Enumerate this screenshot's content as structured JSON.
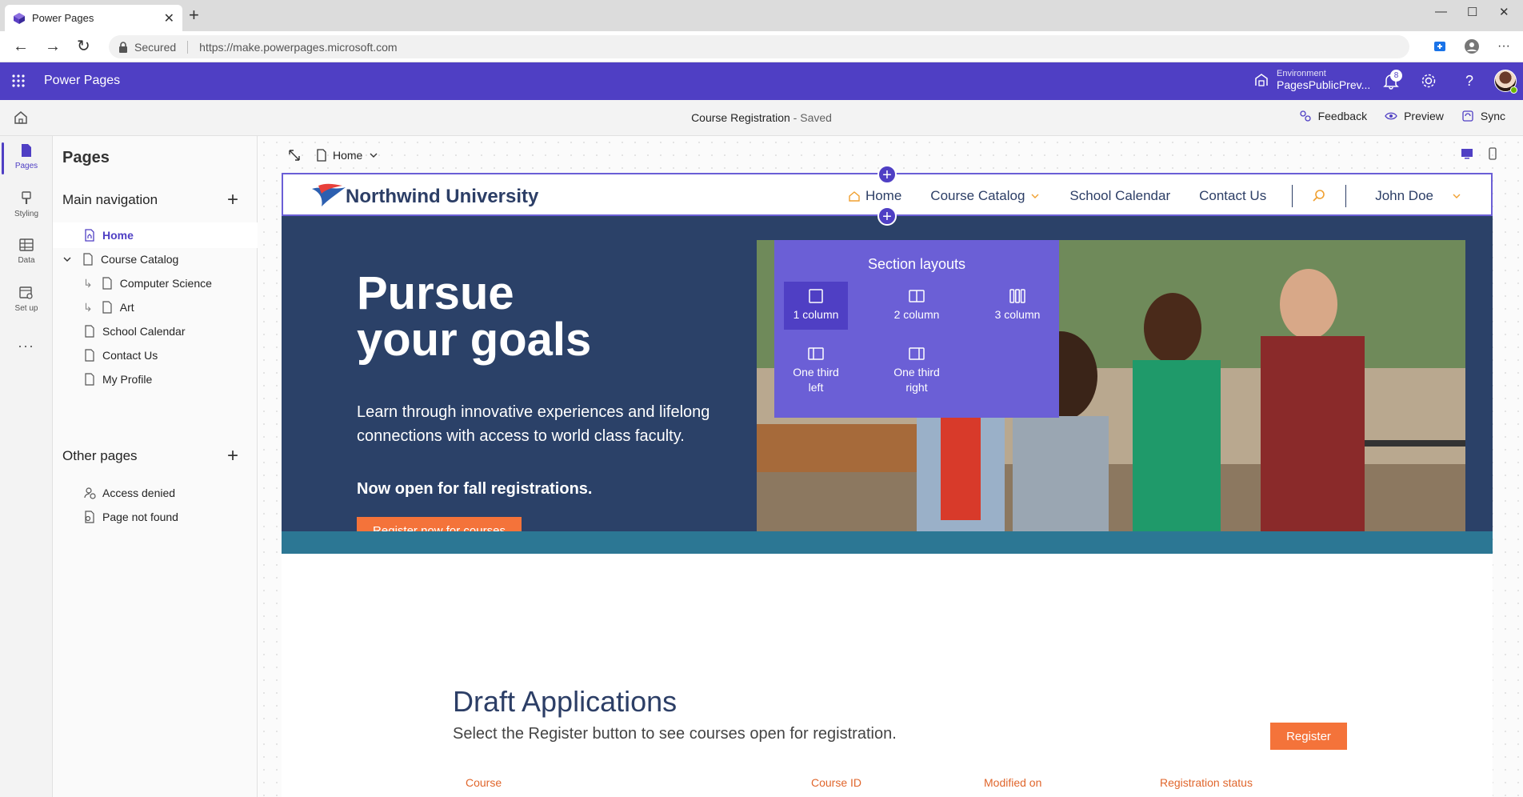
{
  "browser": {
    "tab_title": "Power Pages",
    "secured_label": "Secured",
    "url": "https://make.powerpages.microsoft.com",
    "new_tab": "+",
    "tab_close": "✕",
    "win_min": "—",
    "win_max": "☐",
    "win_close": "✕",
    "back": "←",
    "forward": "→",
    "refresh": "↻",
    "more": "···"
  },
  "appbar": {
    "title": "Power Pages",
    "environment_label": "Environment",
    "environment_name": "PagesPublicPrev...",
    "notification_count": "8",
    "help": "?"
  },
  "commandbar": {
    "doc_title": "Course Registration",
    "doc_status": " - Saved",
    "feedback": "Feedback",
    "preview": "Preview",
    "sync": "Sync"
  },
  "rail": {
    "items": [
      {
        "label": "Pages",
        "icon": "page-icon"
      },
      {
        "label": "Styling",
        "icon": "brush-icon"
      },
      {
        "label": "Data",
        "icon": "table-icon"
      },
      {
        "label": "Set up",
        "icon": "settings-page-icon"
      }
    ],
    "more": "···"
  },
  "panel": {
    "title": "Pages",
    "main_nav_label": "Main navigation",
    "other_pages_label": "Other pages",
    "add": "+",
    "main_nav": [
      {
        "label": "Home"
      },
      {
        "label": "Course Catalog"
      },
      {
        "label": "Computer Science"
      },
      {
        "label": "Art"
      },
      {
        "label": "School Calendar"
      },
      {
        "label": "Contact Us"
      },
      {
        "label": "My Profile"
      }
    ],
    "other_pages": [
      {
        "label": "Access denied"
      },
      {
        "label": "Page not found"
      }
    ],
    "branch": "↳"
  },
  "canvas": {
    "page_picker": "Home",
    "add": "+"
  },
  "site": {
    "name": "Northwind University",
    "nav": {
      "home": "Home",
      "catalog": "Course Catalog",
      "calendar": "School Calendar",
      "contact": "Contact Us",
      "user": "John Doe"
    },
    "hero": {
      "title_line1": "Pursue",
      "title_line2": "your goals",
      "body": "Learn through innovative experiences and lifelong connections with access to world class faculty.",
      "open": "Now open for fall registrations.",
      "cta": "Register now for courses"
    },
    "drafts": {
      "title": "Draft Applications",
      "subtitle": "Select the Register button to see courses open for registration.",
      "register": "Register",
      "columns": [
        "Course",
        "Course ID",
        "Modified on",
        "Registration status"
      ]
    }
  },
  "section_layouts": {
    "title": "Section layouts",
    "options": [
      {
        "label": "1 column"
      },
      {
        "label": "2 column"
      },
      {
        "label": "3 column"
      },
      {
        "label_line1": "One third",
        "label_line2": "left"
      },
      {
        "label_line1": "One third",
        "label_line2": "right"
      }
    ]
  },
  "colors": {
    "brand": "#4f3fc4",
    "flyout": "#6b5fd6",
    "hero": "#2b4168",
    "accent_orange": "#f4733a",
    "teal": "#2c7794"
  }
}
